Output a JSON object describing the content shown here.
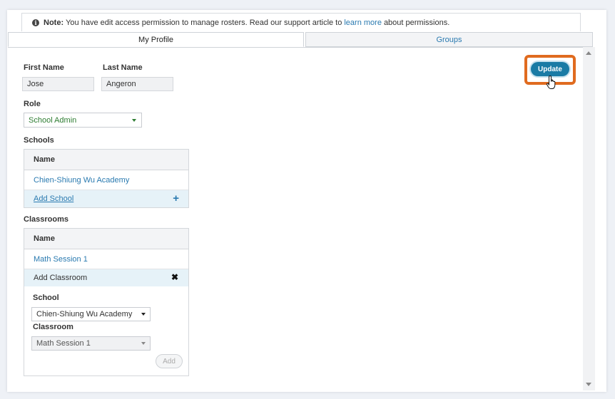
{
  "note": {
    "label": "Note:",
    "text_before": "You have edit access permission to manage rosters. Read our support article to",
    "link": "learn more",
    "text_after": "about permissions."
  },
  "tabs": [
    {
      "label": "My Profile",
      "active": true
    },
    {
      "label": "Groups",
      "active": false
    }
  ],
  "profile": {
    "first_name_label": "First Name",
    "first_name_value": "Jose",
    "last_name_label": "Last Name",
    "last_name_value": "Angeron",
    "role_label": "Role",
    "role_value": "School Admin"
  },
  "schools": {
    "section_label": "Schools",
    "column_header": "Name",
    "items": [
      "Chien-Shiung Wu Academy"
    ],
    "add_label": "Add School"
  },
  "classrooms": {
    "section_label": "Classrooms",
    "column_header": "Name",
    "items": [
      "Math Session 1"
    ],
    "add_label": "Add Classroom",
    "form": {
      "school_label": "School",
      "school_value": "Chien-Shiung Wu Academy",
      "classroom_label": "Classroom",
      "classroom_value": "Math Session 1",
      "add_button": "Add"
    }
  },
  "actions": {
    "update_label": "Update"
  },
  "colors": {
    "accent": "#1a7ba5",
    "link": "#2a7ab0",
    "highlight": "#e06b1f",
    "role_green": "#2e7d32"
  }
}
